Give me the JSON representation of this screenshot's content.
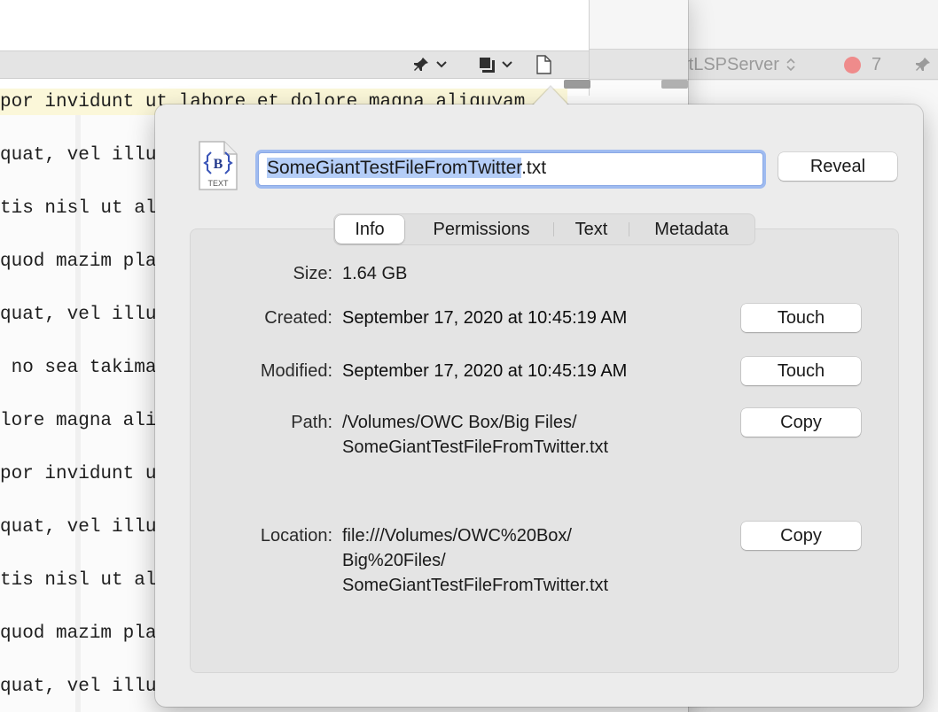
{
  "editor": {
    "lines": [
      "por invidunt ut labore et dolore magna aliquyam",
      "quat, vel illu",
      "tis nisl ut al",
      "quod mazim pla",
      "quat, vel illu",
      " no sea takima",
      "lore magna ali",
      "por invidunt u",
      "quat, vel illu",
      "tis nisl ut al",
      "quod mazim pla",
      "quat, vel illu"
    ]
  },
  "back_window": {
    "scheme_label": "rtLSPServer",
    "error_count": "7"
  },
  "popover": {
    "icon_label": "TEXT",
    "filename_selected": "SomeGiantTestFileFromTwitter",
    "filename_ext": ".txt",
    "reveal_label": "Reveal",
    "tabs": [
      "Info",
      "Permissions",
      "Text",
      "Metadata"
    ],
    "info": {
      "size_label": "Size:",
      "size_value": "1.64 GB",
      "created_label": "Created:",
      "created_value": "September 17, 2020 at 10:45:19 AM",
      "modified_label": "Modified:",
      "modified_value": "September 17, 2020 at 10:45:19 AM",
      "path_label": "Path:",
      "path_line1": "/Volumes/OWC Box/Big Files/",
      "path_line2": "SomeGiantTestFileFromTwitter.txt",
      "location_label": "Location:",
      "location_line1": "file:///Volumes/OWC%20Box/",
      "location_line2": "Big%20Files/",
      "location_line3": "SomeGiantTestFileFromTwitter.txt",
      "touch_label": "Touch",
      "copy_label": "Copy"
    }
  }
}
